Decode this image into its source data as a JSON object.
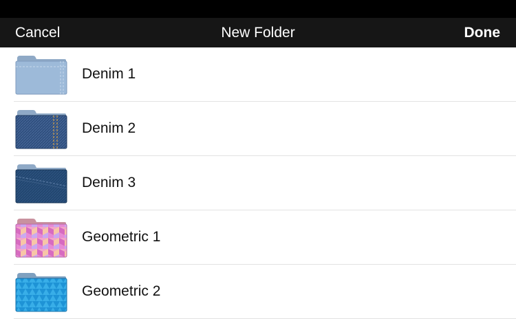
{
  "navbar": {
    "cancel_label": "Cancel",
    "title": "New Folder",
    "done_label": "Done"
  },
  "colors": {
    "navbar_bg": "#161616",
    "status_bar": "#000000",
    "separator": "#e2e2e2"
  },
  "folders": [
    {
      "label": "Denim 1",
      "icon": "denim-light-folder-icon"
    },
    {
      "label": "Denim 2",
      "icon": "denim-medium-folder-icon"
    },
    {
      "label": "Denim 3",
      "icon": "denim-dark-folder-icon"
    },
    {
      "label": "Geometric 1",
      "icon": "geometric-pink-folder-icon"
    },
    {
      "label": "Geometric 2",
      "icon": "geometric-blue-folder-icon"
    }
  ]
}
